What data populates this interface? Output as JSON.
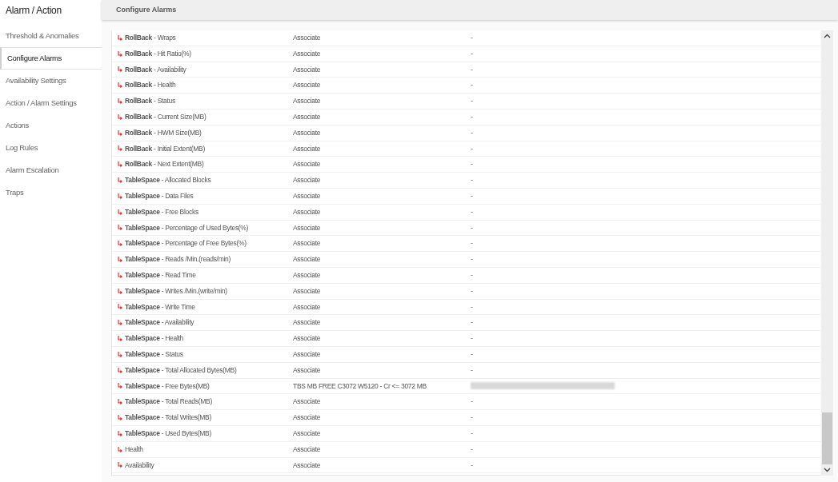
{
  "sidebar": {
    "title": "Alarm / Action",
    "items": [
      {
        "label": "Threshold & Anomalies",
        "selected": false
      },
      {
        "label": "Configure Alarms",
        "selected": true
      },
      {
        "label": "Availability Settings",
        "selected": false
      },
      {
        "label": "Action / Alarm Settings",
        "selected": false
      },
      {
        "label": "Actions",
        "selected": false
      },
      {
        "label": "Log Rules",
        "selected": false
      },
      {
        "label": "Alarm Escalation",
        "selected": false
      },
      {
        "label": "Traps",
        "selected": false
      }
    ]
  },
  "header": {
    "title": "Configure Alarms"
  },
  "table": {
    "rows": [
      {
        "label": "**RollBack** - Wraps",
        "action": "Associate",
        "notify": "-"
      },
      {
        "label": "**RollBack** - Hit Ratio(%)",
        "action": "Associate",
        "notify": "-"
      },
      {
        "label": "**RollBack** - Availability",
        "action": "Associate",
        "notify": "-"
      },
      {
        "label": "**RollBack** - Health",
        "action": "Associate",
        "notify": "-"
      },
      {
        "label": "**RollBack** - Status",
        "action": "Associate",
        "notify": "-"
      },
      {
        "label": "**RollBack** - Current Size(MB)",
        "action": "Associate",
        "notify": "-"
      },
      {
        "label": "**RollBack** - HWM Size(MB)",
        "action": "Associate",
        "notify": "-"
      },
      {
        "label": "**RollBack** - Initial Extent(MB)",
        "action": "Associate",
        "notify": "-"
      },
      {
        "label": "**RollBack** - Next Extent(MB)",
        "action": "Associate",
        "notify": "-"
      },
      {
        "label": "**TableSpace** - Allocated Blocks",
        "action": "Associate",
        "notify": "-"
      },
      {
        "label": "**TableSpace** - Data Files",
        "action": "Associate",
        "notify": "-"
      },
      {
        "label": "**TableSpace** - Free Blocks",
        "action": "Associate",
        "notify": "-"
      },
      {
        "label": "**TableSpace** - Percentage of Used Bytes(%)",
        "action": "Associate",
        "notify": "-"
      },
      {
        "label": "**TableSpace** - Percentage of Free Bytes(%)",
        "action": "Associate",
        "notify": "-"
      },
      {
        "label": "**TableSpace** - Reads /Min.(reads/min)",
        "action": "Associate",
        "notify": "-"
      },
      {
        "label": "**TableSpace** - Read Time",
        "action": "Associate",
        "notify": "-"
      },
      {
        "label": "**TableSpace** - Writes /Min.(write/min)",
        "action": "Associate",
        "notify": "-"
      },
      {
        "label": "**TableSpace** - Write Time",
        "action": "Associate",
        "notify": "-"
      },
      {
        "label": "**TableSpace** - Availability",
        "action": "Associate",
        "notify": "-"
      },
      {
        "label": "**TableSpace** - Health",
        "action": "Associate",
        "notify": "-"
      },
      {
        "label": "**TableSpace** - Status",
        "action": "Associate",
        "notify": "-"
      },
      {
        "label": "**TableSpace** - Total Allocated Bytes(MB)",
        "action": "Associate",
        "notify": "-"
      },
      {
        "label": "**TableSpace** - Free Bytes(MB)",
        "action": "TBS MB FREE C3072 W5120 - Cr <= 3072 MB",
        "notify_redacted": true
      },
      {
        "label": "**TableSpace** - Total Reads(MB)",
        "action": "Associate",
        "notify": "-"
      },
      {
        "label": "**TableSpace** - Total Writes(MB)",
        "action": "Associate",
        "notify": "-"
      },
      {
        "label": "**TableSpace** - Used Bytes(MB)",
        "action": "Associate",
        "notify": "-"
      },
      {
        "label": "Health",
        "action": "Associate",
        "notify": "-"
      },
      {
        "label": "Availability",
        "action": "Associate",
        "notify": "-"
      }
    ]
  }
}
